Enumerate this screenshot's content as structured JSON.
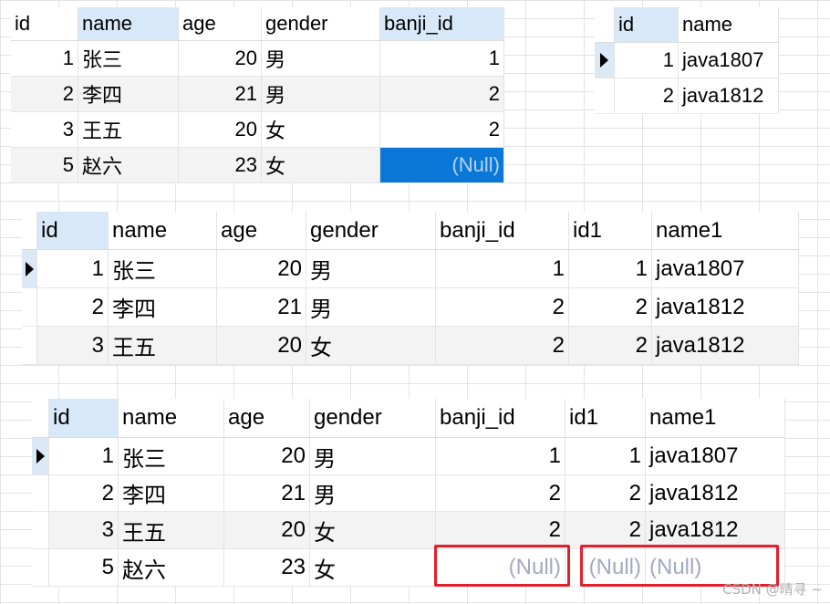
{
  "grid1": {
    "columns": [
      "id",
      "name",
      "age",
      "gender",
      "banji_id"
    ],
    "rows": [
      [
        "1",
        "张三",
        "20",
        "男",
        "1"
      ],
      [
        "2",
        "李四",
        "21",
        "男",
        "2"
      ],
      [
        "3",
        "王五",
        "20",
        "女",
        "2"
      ],
      [
        "5",
        "赵六",
        "23",
        "女",
        "(Null)"
      ]
    ]
  },
  "grid2": {
    "columns": [
      "id",
      "name"
    ],
    "rows": [
      [
        "1",
        "java1807"
      ],
      [
        "2",
        "java1812"
      ]
    ]
  },
  "grid3": {
    "columns": [
      "id",
      "name",
      "age",
      "gender",
      "banji_id",
      "id1",
      "name1"
    ],
    "rows": [
      [
        "1",
        "张三",
        "20",
        "男",
        "1",
        "1",
        "java1807"
      ],
      [
        "2",
        "李四",
        "21",
        "男",
        "2",
        "2",
        "java1812"
      ],
      [
        "3",
        "王五",
        "20",
        "女",
        "2",
        "2",
        "java1812"
      ]
    ]
  },
  "grid4": {
    "columns": [
      "id",
      "name",
      "age",
      "gender",
      "banji_id",
      "id1",
      "name1"
    ],
    "rows": [
      [
        "1",
        "张三",
        "20",
        "男",
        "1",
        "1",
        "java1807"
      ],
      [
        "2",
        "李四",
        "21",
        "男",
        "2",
        "2",
        "java1812"
      ],
      [
        "3",
        "王五",
        "20",
        "女",
        "2",
        "2",
        "java1812"
      ],
      [
        "5",
        "赵六",
        "23",
        "女",
        "(Null)",
        "(Null)",
        "(Null)"
      ]
    ]
  },
  "watermark": "CSDN @晴寻 ~",
  "colors": {
    "selected_cell": "#0b77d6",
    "highlight_box": "#e0202b",
    "null_text": "#a3a9bf",
    "header_selected": "#d7e8f8"
  }
}
